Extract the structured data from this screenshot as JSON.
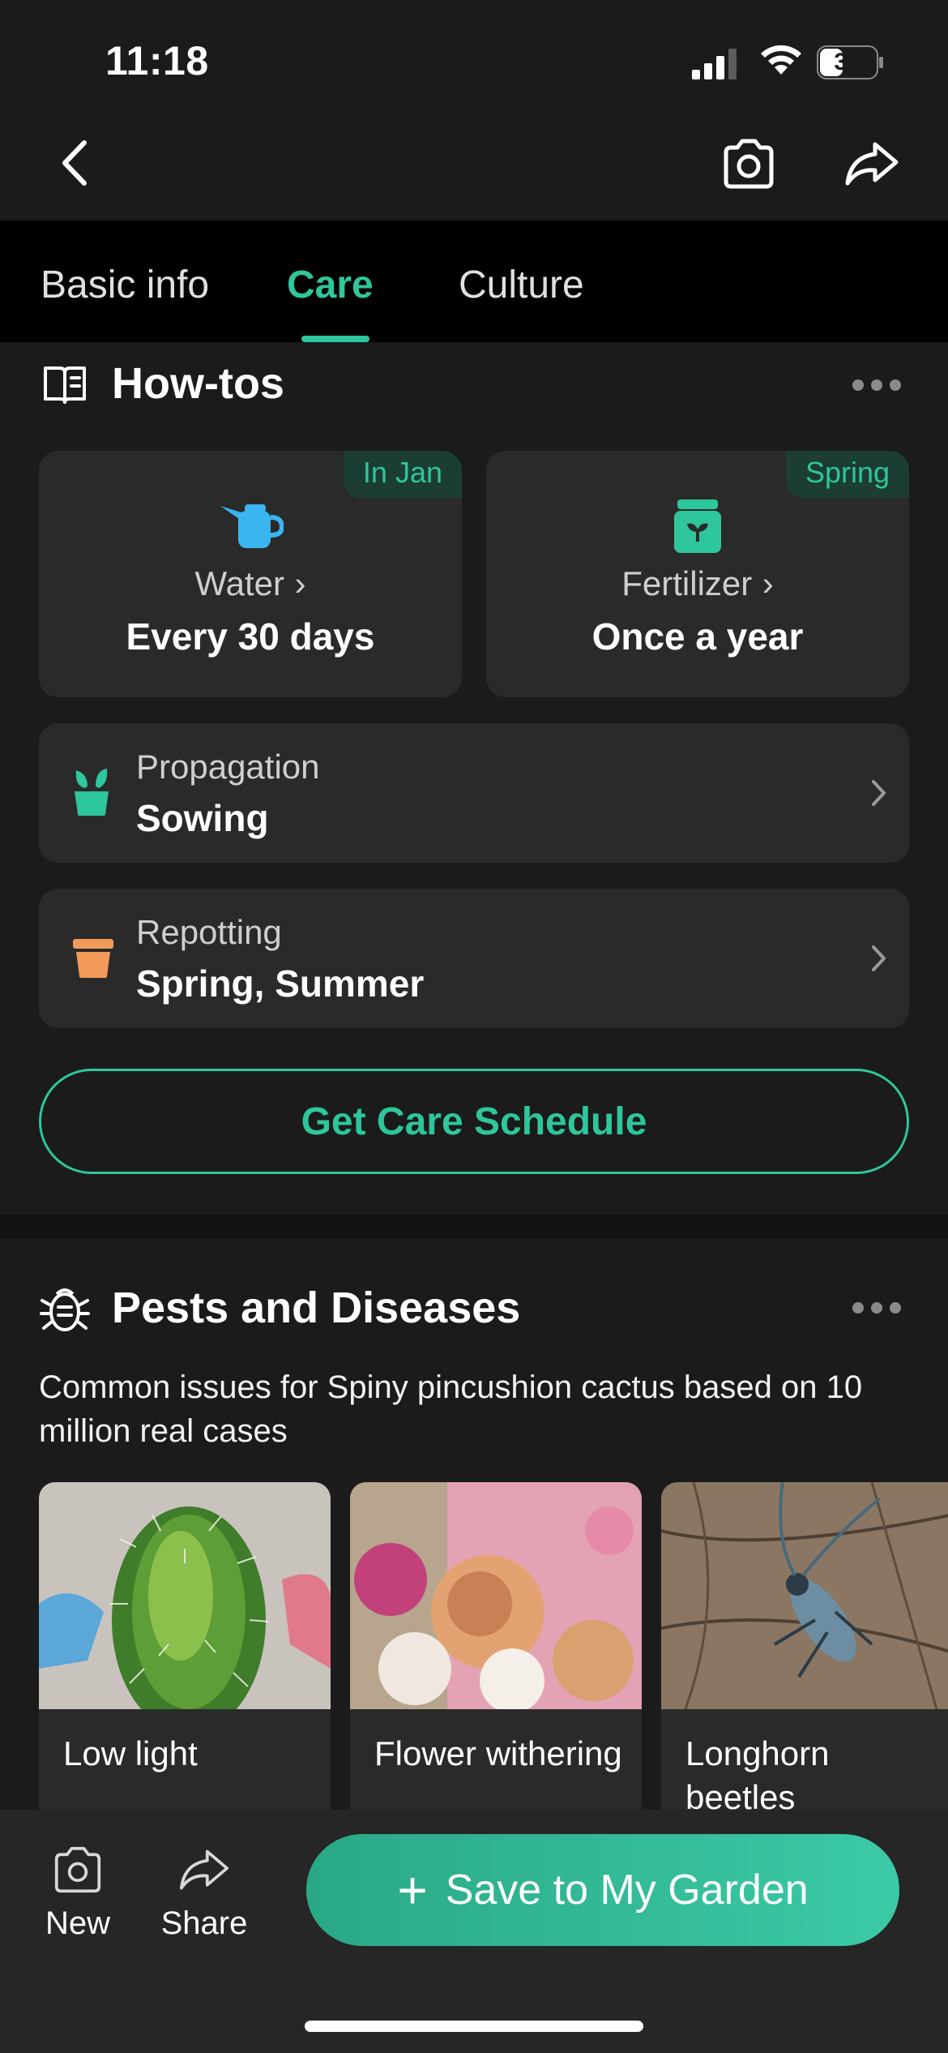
{
  "status": {
    "time": "11:18",
    "battery": "32"
  },
  "tabs": [
    {
      "label": "Basic info"
    },
    {
      "label": "Care"
    },
    {
      "label": "Culture"
    }
  ],
  "howtos": {
    "title": "How-tos",
    "water": {
      "badge": "In Jan",
      "label": "Water",
      "value": "Every 30 days"
    },
    "fertilizer": {
      "badge": "Spring",
      "label": "Fertilizer",
      "value": "Once a year"
    },
    "propagation": {
      "label": "Propagation",
      "value": "Sowing"
    },
    "repotting": {
      "label": "Repotting",
      "value": "Spring, Summer"
    },
    "cta": "Get Care Schedule"
  },
  "pests": {
    "title": "Pests and Diseases",
    "description": "Common issues for Spiny pincushion cactus based on 10 million real cases",
    "items": [
      {
        "label": "Low light"
      },
      {
        "label": "Flower withering"
      },
      {
        "label": "Longhorn beetles"
      }
    ]
  },
  "bottom": {
    "new_label": "New",
    "share_label": "Share",
    "save_label": "Save to My Garden"
  },
  "colors": {
    "accent": "#2ec69b",
    "water_icon": "#3bb5f0",
    "repot_icon": "#f29a5a",
    "background": "#1b1b1b",
    "card": "#2a2a2a"
  },
  "icons": {
    "back": "chevron-left-icon",
    "camera": "camera-icon",
    "share": "share-icon",
    "book": "book-icon",
    "bug": "bug-icon",
    "water": "watering-can-icon",
    "fertilizer": "fertilizer-bag-icon",
    "propagation": "sprout-pot-icon",
    "repotting": "flower-pot-icon"
  }
}
